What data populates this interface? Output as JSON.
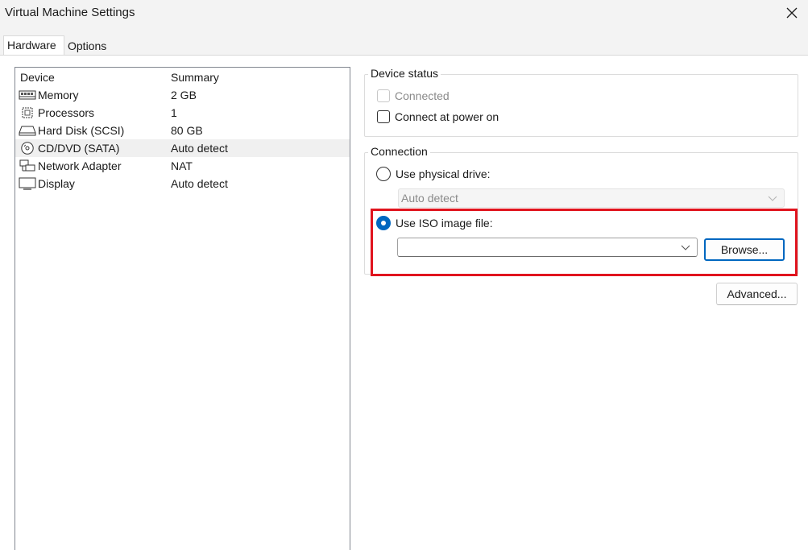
{
  "window": {
    "title": "Virtual Machine Settings"
  },
  "tabs": [
    {
      "label": "Hardware",
      "active": true
    },
    {
      "label": "Options",
      "active": false
    }
  ],
  "device_list": {
    "headers": {
      "device": "Device",
      "summary": "Summary"
    },
    "rows": [
      {
        "icon": "memory-icon",
        "name": "Memory",
        "summary": "2 GB",
        "selected": false
      },
      {
        "icon": "processor-icon",
        "name": "Processors",
        "summary": "1",
        "selected": false
      },
      {
        "icon": "hard-disk-icon",
        "name": "Hard Disk (SCSI)",
        "summary": "80 GB",
        "selected": false
      },
      {
        "icon": "cd-dvd-icon",
        "name": "CD/DVD (SATA)",
        "summary": "Auto detect",
        "selected": true
      },
      {
        "icon": "network-adapter-icon",
        "name": "Network Adapter",
        "summary": "NAT",
        "selected": false
      },
      {
        "icon": "display-icon",
        "name": "Display",
        "summary": "Auto detect",
        "selected": false
      }
    ]
  },
  "device_status": {
    "legend": "Device status",
    "connected_label": "Connected",
    "connected_checked": false,
    "connected_enabled": false,
    "connect_power_on_label": "Connect at power on",
    "connect_power_on_checked": false
  },
  "connection": {
    "legend": "Connection",
    "physical_drive_label": "Use physical drive:",
    "physical_drive_selected": false,
    "physical_drive_value": "Auto detect",
    "iso_label": "Use ISO image file:",
    "iso_selected": true,
    "iso_value": "",
    "browse_label": "Browse..."
  },
  "advanced_label": "Advanced...",
  "colors": {
    "accent": "#0067c0",
    "highlight": "#e0141e"
  }
}
